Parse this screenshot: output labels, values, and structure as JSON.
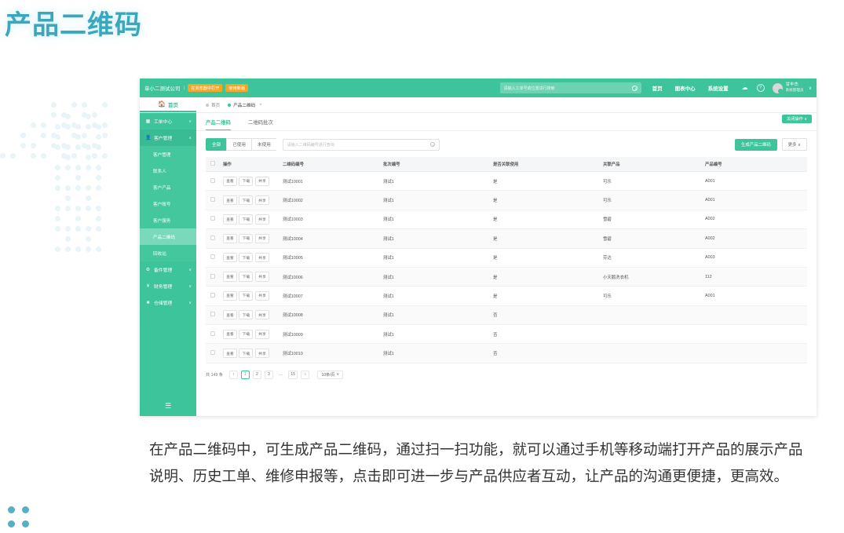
{
  "slide": {
    "title": "产品二维码",
    "caption": "在产品二维码中，可生成产品二维码，通过扫一扫功能，就可以通过手机等移动端打开产品的展示产品说明、历史工单、维修申报等，点击即可进一步与产品供应者互动，让产品的沟通更便捷，更高效。",
    "accent_color": "#3aa7bd",
    "brand_color": "#3ec49a"
  },
  "app": {
    "topbar": {
      "company": "单小二测试公司",
      "separator": "|",
      "badges": [
        "在浏览器中打开",
        "使用新版"
      ],
      "search_placeholder": "请输入工单号或位置进行搜索",
      "search_icon": "search-icon",
      "nav": [
        "首页",
        "图表中心",
        "系统设置"
      ],
      "cloud_icon": "cloud-upload-icon",
      "help_icon": "help-icon",
      "user_name": "甘丰杰",
      "user_role": "系统管理员",
      "caret": "∨"
    },
    "tabstrip": {
      "home_label": "首页",
      "home_icon": "home-icon",
      "crumbs": [
        {
          "label": "首页",
          "active": false
        },
        {
          "label": "产品二维码",
          "active": true,
          "close": "×"
        }
      ],
      "close_ops_label": "关闭操作 ∨"
    },
    "sidebar": {
      "items": [
        {
          "label": "工单中心",
          "icon": "clipboard-icon",
          "chevron": "∨",
          "type": "group"
        },
        {
          "label": "客户管理",
          "icon": "user-icon",
          "chevron": "∧",
          "type": "group",
          "open": true
        },
        {
          "label": "客户管理",
          "type": "sub"
        },
        {
          "label": "联系人",
          "type": "sub"
        },
        {
          "label": "客户产品",
          "type": "sub"
        },
        {
          "label": "客户账号",
          "type": "sub"
        },
        {
          "label": "客户服务",
          "type": "sub"
        },
        {
          "label": "产品二维码",
          "type": "sub",
          "active": true
        },
        {
          "label": "回收站",
          "type": "sub"
        },
        {
          "label": "备件管理",
          "icon": "gear-icon",
          "chevron": "∨",
          "type": "group"
        },
        {
          "label": "财务管理",
          "icon": "yuan-icon",
          "chevron": "∨",
          "type": "group"
        },
        {
          "label": "仓储管理",
          "icon": "box-icon",
          "chevron": "∨",
          "type": "group"
        }
      ],
      "burger_icon": "menu-icon"
    },
    "content": {
      "tabs": [
        {
          "label": "产品二维码",
          "active": true
        },
        {
          "label": "二维码批次",
          "active": false
        }
      ],
      "filters": [
        {
          "label": "全部",
          "active": true
        },
        {
          "label": "已使用",
          "active": false
        },
        {
          "label": "未使用",
          "active": false
        }
      ],
      "search_placeholder": "请输入二维码编号进行查询",
      "search_icon": "search-icon",
      "primary_button": "生成产品二维码",
      "more_button": "更多 ∨",
      "table": {
        "columns": [
          "",
          "操作",
          "二维码编号",
          "批次编号",
          "是否关联使用",
          "关联产品",
          "产品编号"
        ],
        "row_actions": [
          "查看",
          "下载",
          "共享"
        ],
        "rows": [
          {
            "code": "测试10001",
            "batch": "测试1",
            "used": "是",
            "product": "可乐",
            "product_no": "A001"
          },
          {
            "code": "测试10002",
            "batch": "测试1",
            "used": "是",
            "product": "可乐",
            "product_no": "A001"
          },
          {
            "code": "测试10003",
            "batch": "测试1",
            "used": "是",
            "product": "雪碧",
            "product_no": "A002"
          },
          {
            "code": "测试10004",
            "batch": "测试1",
            "used": "是",
            "product": "雪碧",
            "product_no": "A002"
          },
          {
            "code": "测试10005",
            "batch": "测试1",
            "used": "是",
            "product": "芬达",
            "product_no": "A003"
          },
          {
            "code": "测试10006",
            "batch": "测试1",
            "used": "是",
            "product": "小天鹅洗衣机",
            "product_no": "112"
          },
          {
            "code": "测试10007",
            "batch": "测试1",
            "used": "是",
            "product": "可乐",
            "product_no": "A001"
          },
          {
            "code": "测试10008",
            "batch": "测试1",
            "used": "否",
            "product": "",
            "product_no": ""
          },
          {
            "code": "测试10009",
            "batch": "测试1",
            "used": "否",
            "product": "",
            "product_no": ""
          },
          {
            "code": "测试10010",
            "batch": "测试1",
            "used": "否",
            "product": "",
            "product_no": ""
          }
        ]
      },
      "pager": {
        "total": "共 149 条",
        "prev": "‹",
        "next": "›",
        "pages": [
          "1",
          "2",
          "3",
          "…",
          "15"
        ],
        "current": "1",
        "page_size": "10条/页",
        "page_size_caret": "∨"
      }
    }
  }
}
